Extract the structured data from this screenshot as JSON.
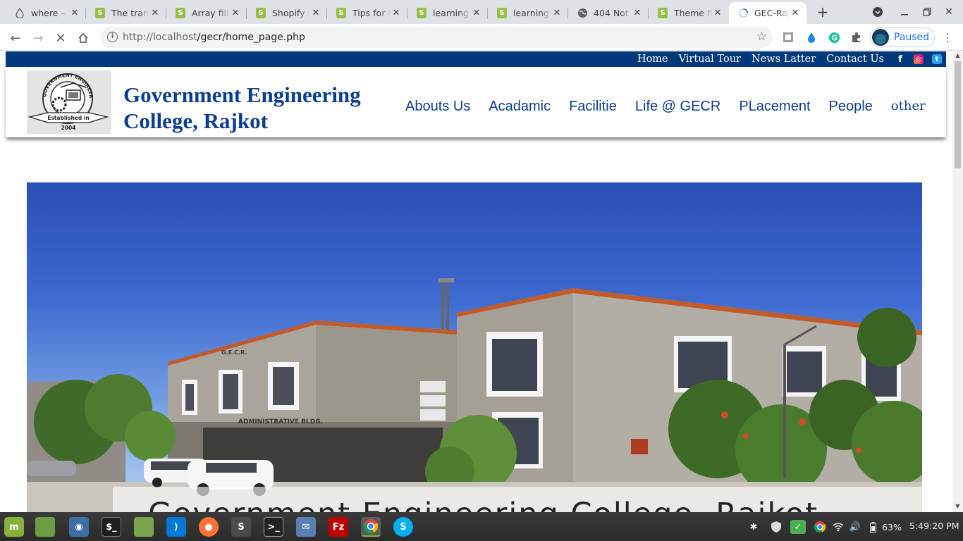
{
  "browser": {
    "tabs": [
      {
        "label": "where – I",
        "favicon": "drop-icon"
      },
      {
        "label": "The tran",
        "favicon": "shopify-icon"
      },
      {
        "label": "Array fill",
        "favicon": "shopify-icon"
      },
      {
        "label": "Shopify C",
        "favicon": "shopify-icon"
      },
      {
        "label": "Tips for t",
        "favicon": "shopify-icon"
      },
      {
        "label": "learning",
        "favicon": "shopify-icon"
      },
      {
        "label": "learning",
        "favicon": "shopify-icon"
      },
      {
        "label": "404 Not",
        "favicon": "globe-icon"
      },
      {
        "label": "Theme fi",
        "favicon": "shopify-icon"
      },
      {
        "label": "GEC-Rajk",
        "favicon": "loading-icon",
        "active": true
      }
    ],
    "address": {
      "host": "http://localhost",
      "path": "/gecr/home_page.php"
    },
    "profile_label": "Paused"
  },
  "site": {
    "topnav": [
      "Home",
      "Virtual Tour",
      "News Latter",
      "Contact Us"
    ],
    "social": [
      "facebook-icon",
      "instagram-icon",
      "twitter-icon"
    ],
    "logo": {
      "ring_text": "GOVERNMENT ENGINEERING COLLEGE RAJKOT",
      "ribbon": "Established in",
      "year": "2004"
    },
    "brand_line1": "Government Engineering",
    "brand_line2": "College, Rajkot",
    "mainnav": [
      "Abouts Us",
      "Acadamic",
      "Facilitie",
      "Life @ GECR",
      "PLacement",
      "People",
      "other"
    ],
    "hero": {
      "caption": "Government Engineering College, Rajkot",
      "building_sign_top": "G.E.C.R.",
      "building_sign": "ADMINISTRATIVE BLDG."
    }
  },
  "taskbar": {
    "battery": "63%",
    "clock": "5:49:20 PM"
  },
  "colors": {
    "brand_blue": "#0b3d91",
    "topbar": "#00397a",
    "sky": "#2a4fb6"
  }
}
